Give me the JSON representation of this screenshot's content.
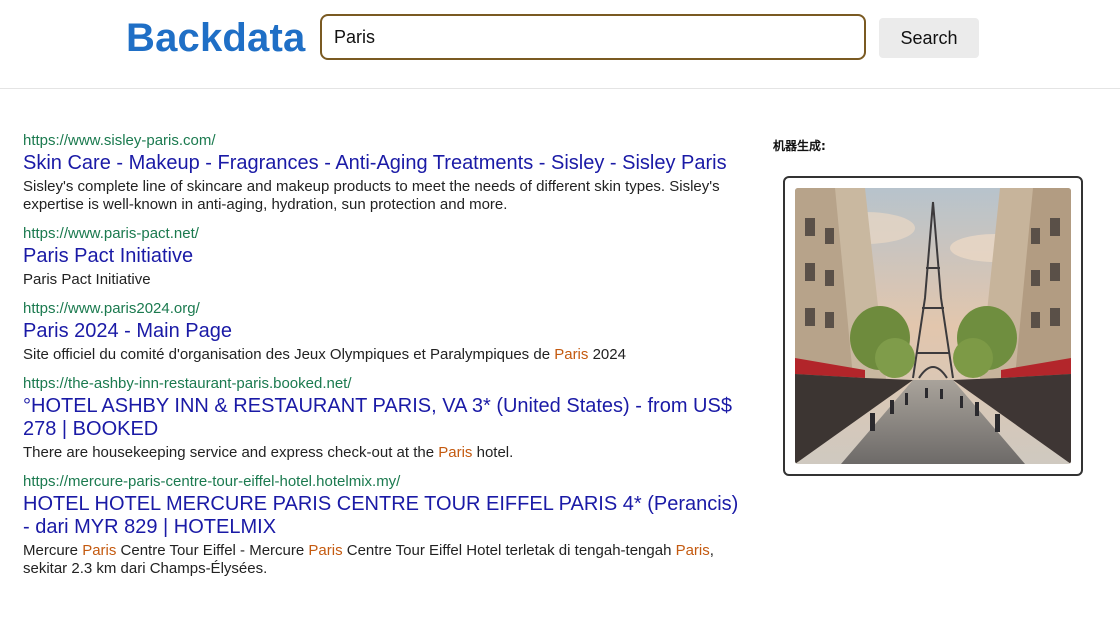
{
  "header": {
    "logo": "Backdata",
    "search_value": "Paris",
    "search_button": "Search"
  },
  "results": [
    {
      "url": "https://www.sisley-paris.com/",
      "title": "Skin Care - Makeup - Fragrances - Anti-Aging Treatments - Sisley - Sisley Paris",
      "snippet": [
        {
          "text": "Sisley's complete line of skincare and makeup products to meet the needs of different skin types. Sisley's expertise is well-known in anti-aging, hydration, sun protection and more.",
          "hl": false
        }
      ]
    },
    {
      "url": "https://www.paris-pact.net/",
      "title": "Paris Pact Initiative",
      "snippet": [
        {
          "text": "Paris Pact Initiative",
          "hl": false
        }
      ]
    },
    {
      "url": "https://www.paris2024.org/",
      "title": "Paris 2024 - Main Page",
      "snippet": [
        {
          "text": "Site officiel du comité d'organisation des Jeux Olympiques et Paralympiques de ",
          "hl": false
        },
        {
          "text": "Paris",
          "hl": true
        },
        {
          "text": " 2024",
          "hl": false
        }
      ]
    },
    {
      "url": "https://the-ashby-inn-restaurant-paris.booked.net/",
      "title": "°HOTEL ASHBY INN & RESTAURANT PARIS, VA 3* (United States) - from US$ 278 | BOOKED",
      "snippet": [
        {
          "text": "There are housekeeping service and express check-out at the ",
          "hl": false
        },
        {
          "text": "Paris",
          "hl": true
        },
        {
          "text": " hotel.",
          "hl": false
        }
      ]
    },
    {
      "url": "https://mercure-paris-centre-tour-eiffel-hotel.hotelmix.my/",
      "title": "HOTEL HOTEL MERCURE PARIS CENTRE TOUR EIFFEL PARIS 4* (Perancis) - dari MYR 829 | HOTELMIX",
      "snippet": [
        {
          "text": "Mercure ",
          "hl": false
        },
        {
          "text": "Paris",
          "hl": true
        },
        {
          "text": " Centre Tour Eiffel - Mercure ",
          "hl": false
        },
        {
          "text": "Paris",
          "hl": true
        },
        {
          "text": " Centre Tour Eiffel Hotel terletak di tengah-tengah ",
          "hl": false
        },
        {
          "text": "Paris",
          "hl": true
        },
        {
          "text": ", sekitar 2.3 km dari Champs-Élysées.",
          "hl": false
        }
      ]
    }
  ],
  "sidebar": {
    "label": "机器生成:",
    "image_icon": "eiffel-tower-street-painting"
  },
  "colors": {
    "logo": "#1f6fc6",
    "url": "#1b7a4f",
    "title": "#1a1aa6",
    "highlight": "#c45a10"
  }
}
